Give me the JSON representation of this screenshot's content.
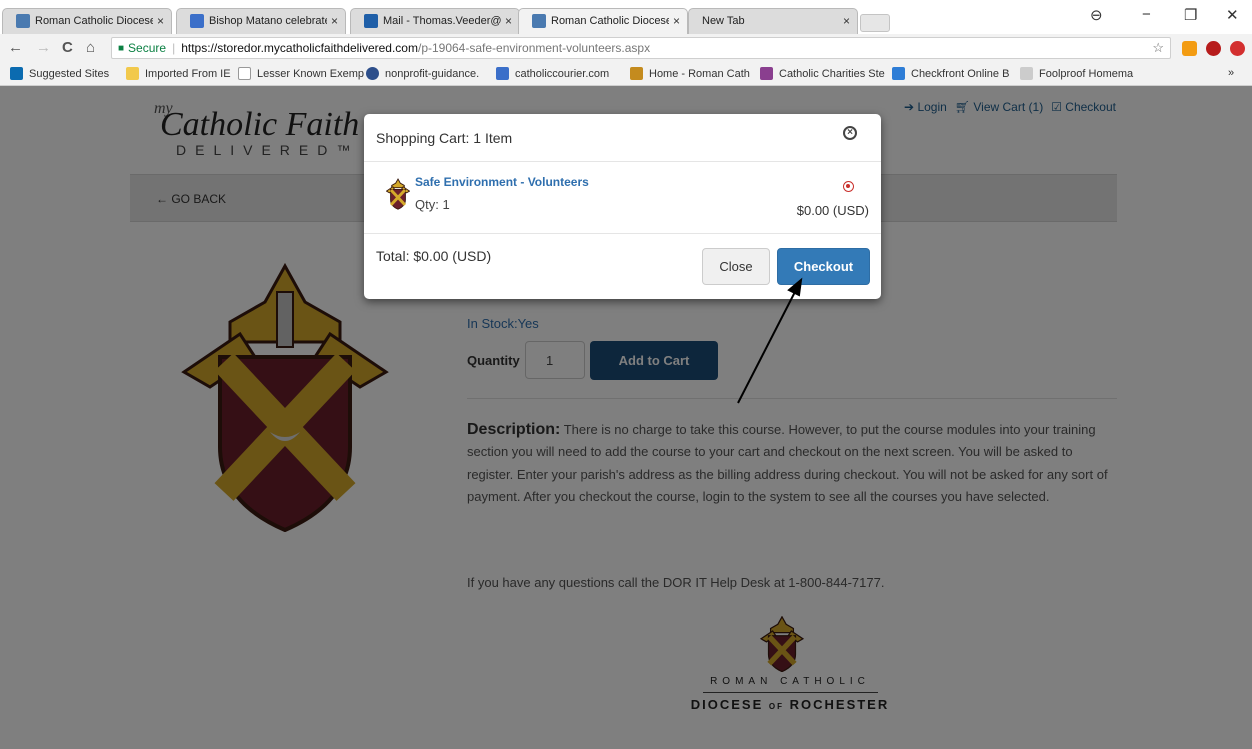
{
  "browser": {
    "tabs": [
      {
        "title": "Roman Catholic Diocese",
        "favicon_color": "#4a7ab0",
        "active": false
      },
      {
        "title": "Bishop Matano celebrate",
        "favicon_color": "#3b6fc9",
        "active": false
      },
      {
        "title": "Mail - Thomas.Veeder@",
        "favicon_color": "#1f5fa8",
        "active": false
      },
      {
        "title": "Roman Catholic Diocese",
        "favicon_color": "#4a7ab0",
        "active": true
      },
      {
        "title": "New Tab",
        "favicon_color": "",
        "active": false
      }
    ],
    "tab_close_glyph": "×",
    "window_controls": {
      "minimize": "−",
      "restore": "❐",
      "close": "✕"
    },
    "nav": {
      "back": "←",
      "forward": "→",
      "reload": "C",
      "home": "⌂"
    },
    "address": {
      "secure_label": "Secure",
      "host": "https://storedor.mycatholicfaithdelivered.com",
      "path": "/p-19064-safe-environment-volunteers.aspx"
    },
    "bookmarks": [
      {
        "label": "Suggested Sites",
        "color": "#0b6bb0"
      },
      {
        "label": "Imported From IE",
        "color": "#f2c94c"
      },
      {
        "label": "Lesser Known Exemp",
        "color": "#ffffff"
      },
      {
        "label": "nonprofit-guidance.",
        "color": "#2d4f8b"
      },
      {
        "label": "catholiccourier.com",
        "color": "#3b6fc9"
      },
      {
        "label": "Home - Roman Cath",
        "color": "#c48b1e"
      },
      {
        "label": "Catholic Charities Ste",
        "color": "#8a3f8f"
      },
      {
        "label": "Checkfront Online B",
        "color": "#2e7dd6"
      },
      {
        "label": "Foolproof Homema",
        "color": "#cccccc"
      }
    ],
    "bookmarks_overflow": "»"
  },
  "site": {
    "logo_my": "my",
    "logo_main": "Catholic Faith",
    "logo_sub": "DELIVERED™",
    "top_links": {
      "login": "Login",
      "view_cart": "View Cart (1)",
      "checkout": "Checkout"
    },
    "go_back": "← GO BACK"
  },
  "product": {
    "in_stock": "In Stock:Yes",
    "quantity_label": "Quantity",
    "quantity_value": "1",
    "add_to_cart": "Add to Cart",
    "description_label": "Description:",
    "description_text": "There is no charge to take this course. However, to put the course modules into your training section you will need to add the course to your cart and checkout on the next screen. You will be asked to register. Enter your parish's address as the billing address during checkout. You will not be asked for any sort of payment. After you checkout the course, login to the system to see all the courses you have selected.",
    "help_text": "If you have any questions call the DOR IT Help Desk at 1-800-844-7177.",
    "footer_top": "ROMAN CATHOLIC",
    "footer_diocese": "DIOCESE",
    "footer_of": "OF",
    "footer_rochester": "ROCHESTER"
  },
  "modal": {
    "title": "Shopping Cart: 1 Item",
    "close_glyph": "×",
    "item_name": "Safe Environment - Volunteers",
    "item_qty": "Qty: 1",
    "item_price": "$0.00 (USD)",
    "total": "Total: $0.00 (USD)",
    "close_button": "Close",
    "checkout_button": "Checkout"
  },
  "colors": {
    "crest_gold": "#d4a92a",
    "crest_maroon": "#6b1f2a",
    "primary": "#337ab7"
  }
}
